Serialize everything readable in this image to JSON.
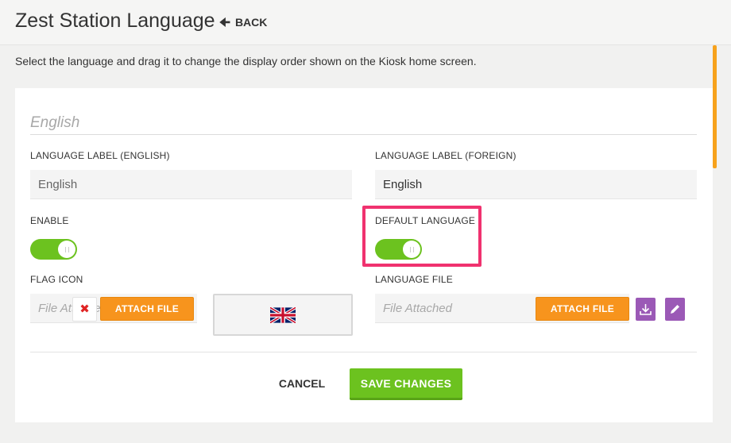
{
  "header": {
    "title": "Zest Station Language",
    "back_label": "BACK",
    "back_icon": "arrow-left-icon"
  },
  "instruction": "Select the language and drag it to change the display order shown on the Kiosk home screen.",
  "language": {
    "name": "English",
    "label_english": {
      "label": "LANGUAGE LABEL (ENGLISH)",
      "value": "English"
    },
    "label_foreign": {
      "label": "LANGUAGE LABEL (FOREIGN)",
      "value": "English"
    },
    "enable": {
      "label": "ENABLE",
      "on": true
    },
    "default_language": {
      "label": "DEFAULT LANGUAGE",
      "on": true
    },
    "flag_icon": {
      "label": "FLAG ICON",
      "placeholder": "File Attached",
      "attach_label": "ATTACH FILE",
      "remove_icon": "close-x-icon",
      "preview_icon": "uk-flag-icon"
    },
    "language_file": {
      "label": "LANGUAGE FILE",
      "placeholder": "File Attached",
      "attach_label": "ATTACH FILE",
      "download_icon": "download-icon",
      "edit_icon": "pencil-icon"
    }
  },
  "actions": {
    "cancel_label": "CANCEL",
    "save_label": "SAVE CHANGES"
  },
  "colors": {
    "accent_orange": "#f7941d",
    "toggle_green": "#6cc21f",
    "icon_purple": "#9b59b6",
    "highlight_pink": "#f0326f"
  }
}
